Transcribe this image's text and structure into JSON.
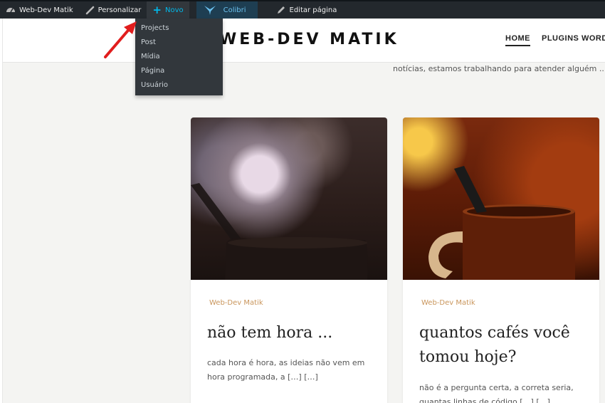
{
  "adminbar": {
    "site_name": "Web-Dev Matik",
    "customize": "Personalizar",
    "new": "Novo",
    "colibri": "Colibri",
    "edit_page": "Editar página"
  },
  "new_menu": {
    "items": [
      "Projects",
      "Post",
      "Mídia",
      "Página",
      "Usuário"
    ]
  },
  "site": {
    "title": "WEB-DEV MATIK",
    "nav": [
      "HOME",
      "PLUGINS WORDP"
    ],
    "subtitle": "notícias, estamos trabalhando para atender alguém ..."
  },
  "posts": [
    {
      "category": "Web-Dev Matik",
      "title": "não tem hora ...",
      "excerpt": "cada hora é hora, as ideias não vem em hora programada, a […] […]"
    },
    {
      "category": "Web-Dev Matik",
      "title": "quantos cafés você tomou hoje?",
      "excerpt": "não é a pergunta certa, a correta seria, quantas linhas de código […] […]"
    }
  ],
  "colors": {
    "adminbar_bg": "#23282d",
    "dropdown_bg": "#32373c",
    "accent": "#00b9eb",
    "category": "#c9955b",
    "arrow": "#e11d1d"
  }
}
